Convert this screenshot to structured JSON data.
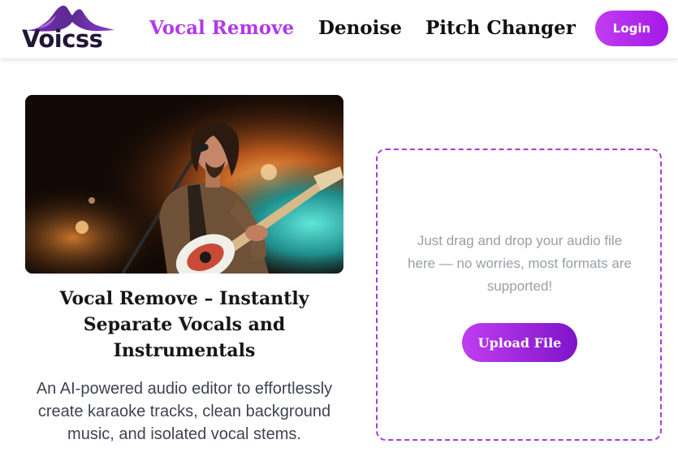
{
  "brand": {
    "name": "Voicss",
    "accent_color": "#b23ae8",
    "logo_icon": "sound-wave-icon"
  },
  "nav": {
    "items": [
      {
        "label": "Vocal Remove",
        "active": true
      },
      {
        "label": "Denoise",
        "active": false
      },
      {
        "label": "Pitch Changer",
        "active": false
      }
    ],
    "login_label": "Login"
  },
  "hero": {
    "image": "guitarist-singing-on-stage-photo",
    "title": "Vocal Remove – Instantly Separate Vocals and Instrumentals",
    "description": "An AI-powered audio editor to effortlessly create karaoke tracks, clean background music, and isolated vocal stems."
  },
  "upload": {
    "drop_text": "Just drag and drop your audio file here — no worries, most formats are supported!",
    "button_label": "Upload File",
    "border_color": "#a93ad9"
  }
}
